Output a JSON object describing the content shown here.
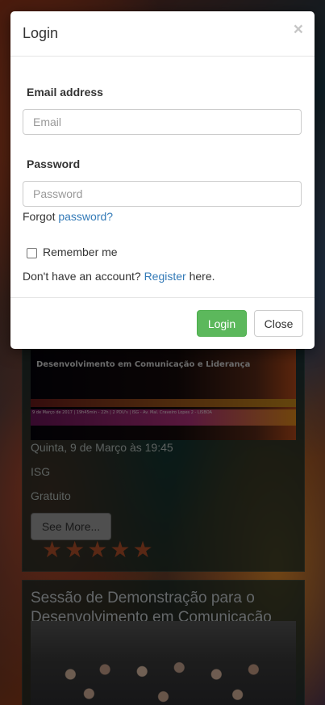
{
  "modal": {
    "title": "Login",
    "close_glyph": "×",
    "email_label": "Email address",
    "email_placeholder": "Email",
    "email_value": "",
    "password_label": "Password",
    "password_placeholder": "Password",
    "password_value": "",
    "forgot_prefix": "Forgot",
    "forgot_link": "password?",
    "remember_label": "Remember me",
    "remember_checked": false,
    "register_prefix": "Don't have an account?",
    "register_link": "Register",
    "register_suffix": "here.",
    "login_button": "Login",
    "close_button": "Close",
    "colors": {
      "primary_link": "#337ab7",
      "success": "#5cb85c"
    }
  },
  "events": [
    {
      "poster_title": "Desenvolvimento em Comunicação e Liderança",
      "poster_strip": "9 de Março de  2017 | 19h45min - 22h | 2 PDU's | ISG - Av. Mal. Craveiro Lopes 2 - LISBOA",
      "date": "Quinta, 9 de Março às 19:45",
      "location": "ISG",
      "price": "Gratuito",
      "see_more": "See More...",
      "rating": 5,
      "star_icon": "star-icon"
    },
    {
      "title": "Sessão de Demonstração para o Desenvolvimento em Comunicação"
    }
  ]
}
